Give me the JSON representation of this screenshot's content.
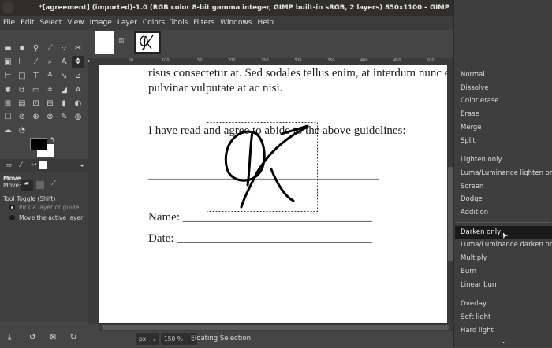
{
  "window": {
    "title": "*[agreement] (imported)-1.0 (RGB color 8-bit gamma integer, GIMP built-in sRGB, 2 layers) 850x1100 – GIMP"
  },
  "menubar": [
    "File",
    "Edit",
    "Select",
    "View",
    "Image",
    "Layer",
    "Colors",
    "Tools",
    "Filters",
    "Windows",
    "Help"
  ],
  "tool_options": {
    "title": "Move",
    "move_label": "Move:",
    "toggle_label": "Tool Toggle  (Shift)",
    "options": [
      "Pick a layer or guide",
      "Move the active layer"
    ],
    "selected": 0
  },
  "ruler": {
    "marks": [
      "50",
      "100",
      "150",
      "200",
      "250",
      "300",
      "350",
      "400",
      "450",
      "500"
    ]
  },
  "document": {
    "line1": "risus consectetur at. Sed sodales tellus enim, at interdum nunc ele",
    "line2": "pulvinar vulputate at ac nisi.",
    "agree": "I have read and agree to abide to the above guidelines:",
    "signature_line": "_______________________________________",
    "name": "Name: ________________________________",
    "date": "Date: _________________________________"
  },
  "statusbar": {
    "unit": "px",
    "zoom": "150 %",
    "message": "Floating Selection"
  },
  "blend_menu": {
    "groups": [
      [
        "Normal",
        "Dissolve",
        "Color erase",
        "Erase",
        "Merge",
        "Split"
      ],
      [
        "Lighten only",
        "Luma/Luminance lighten only",
        "Screen",
        "Dodge",
        "Addition"
      ],
      [
        "Darken only",
        "Luma/Luminance darken only",
        "Multiply",
        "Burn",
        "Linear burn"
      ],
      [
        "Overlay",
        "Soft light",
        "Hard light"
      ]
    ],
    "highlighted": "Darken only"
  },
  "colors": {
    "foreground": "#000000",
    "background": "#ffffff",
    "highlight": "#1a1a1a"
  }
}
